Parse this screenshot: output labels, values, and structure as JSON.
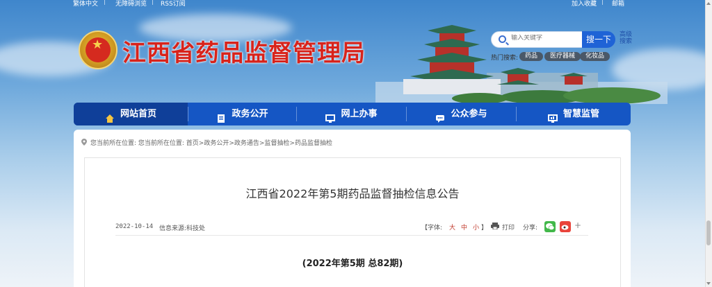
{
  "topbar": {
    "traditional": "繁体中文",
    "accessible": "无障碍浏览",
    "rss": "RSS订阅",
    "favorite": "加入收藏",
    "email": "邮箱"
  },
  "header": {
    "site_title": "江西省药品监督管理局",
    "search_placeholder": "输入关键字",
    "search_button": "搜一下",
    "advanced_search": "高级搜索",
    "hot_label": "热门搜索:",
    "hot_tags": [
      "药品",
      "医疗器械",
      "化妆品"
    ]
  },
  "nav": {
    "items": [
      {
        "label": "网站首页",
        "icon": "home-icon"
      },
      {
        "label": "政务公开",
        "icon": "document-icon"
      },
      {
        "label": "网上办事",
        "icon": "monitor-icon"
      },
      {
        "label": "公众参与",
        "icon": "chat-icon"
      },
      {
        "label": "智慧监管",
        "icon": "smart-monitor-icon"
      }
    ],
    "active": 0
  },
  "breadcrumb": {
    "text": "您当前所在位置:  您当前所在位置: 首页>政务公开>政务通告>监督抽检>药品监督抽检"
  },
  "article": {
    "title": "江西省2022年第5期药品监督抽检信息公告",
    "date": "2022-10-14",
    "source": "信息来源:科技处",
    "font_label": "【字体:",
    "font_large": "大",
    "font_medium": "中",
    "font_small": "小",
    "font_close": "】",
    "print": "打印",
    "share": "分享:",
    "share_more": "+",
    "issue": "(2022年第5期     总82期)"
  },
  "colors": {
    "title_red": "#d8231b",
    "nav_blue": "#1556c4",
    "nav_active": "#0f3f99",
    "search_blue": "#1f63d6"
  }
}
